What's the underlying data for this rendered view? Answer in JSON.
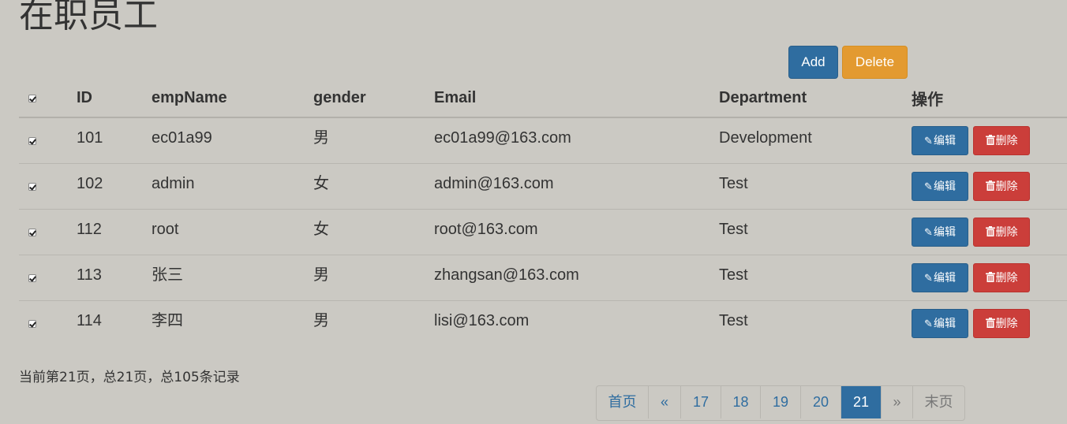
{
  "page": {
    "title": "在职员工"
  },
  "toolbar": {
    "add_label": "Add",
    "delete_label": "Delete"
  },
  "table": {
    "headers": {
      "id": "ID",
      "name": "empName",
      "gender": "gender",
      "email": "Email",
      "department": "Department",
      "actions": "操作"
    },
    "header_checkbox_checked": true,
    "edit_label": "编辑",
    "delete_label": "删除",
    "rows": [
      {
        "checked": true,
        "id": "101",
        "name": "ec01a99",
        "gender": "男",
        "email": "ec01a99@163.com",
        "department": "Development"
      },
      {
        "checked": true,
        "id": "102",
        "name": "admin",
        "gender": "女",
        "email": "admin@163.com",
        "department": "Test"
      },
      {
        "checked": true,
        "id": "112",
        "name": "root",
        "gender": "女",
        "email": "root@163.com",
        "department": "Test"
      },
      {
        "checked": true,
        "id": "113",
        "name": "张三",
        "gender": "男",
        "email": "zhangsan@163.com",
        "department": "Test"
      },
      {
        "checked": true,
        "id": "114",
        "name": "李四",
        "gender": "男",
        "email": "lisi@163.com",
        "department": "Test"
      }
    ]
  },
  "pagination_info": {
    "text": "当前第21页，总21页，总105条记录"
  },
  "pagination": {
    "first": "首页",
    "prev": "«",
    "pages": [
      "17",
      "18",
      "19",
      "20",
      "21"
    ],
    "current": "21",
    "next": "»",
    "last": "末页"
  },
  "colors": {
    "background": "#cbc9c3",
    "primary": "#2f6da0",
    "warning": "#e39a30",
    "danger": "#cb3e3a"
  },
  "icons": {
    "edit": "pencil-icon",
    "delete": "trash-icon"
  }
}
